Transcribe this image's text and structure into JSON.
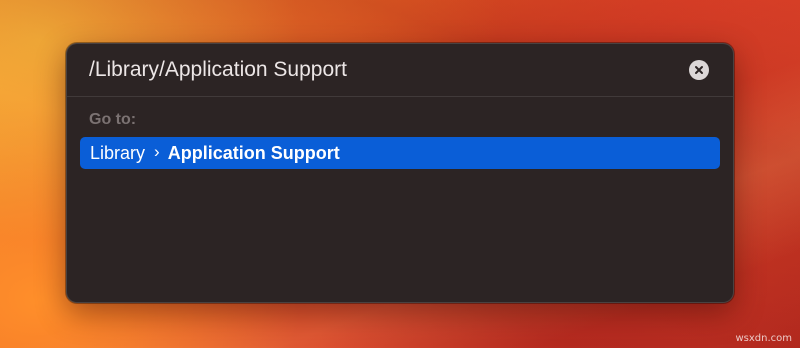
{
  "dialog": {
    "path_value": "/Library/Application Support",
    "goto_label": "Go to:",
    "clear_icon": "close-circle-icon",
    "suggestion": {
      "parent": "Library",
      "separator": "›",
      "current": "Application Support"
    }
  },
  "colors": {
    "panel_bg": "#2c2424",
    "selection": "#0a5ed7",
    "goto_label": "#7b7272"
  },
  "watermark": "wsxdn.com"
}
